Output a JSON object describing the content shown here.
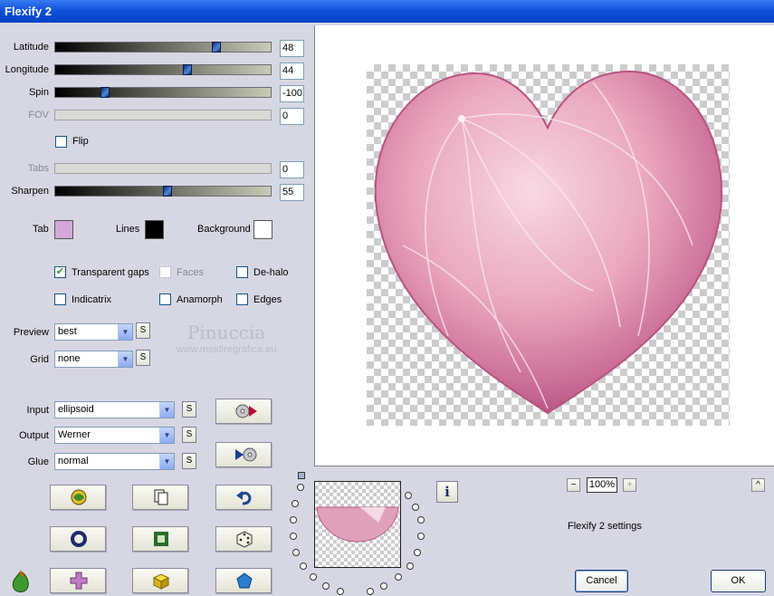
{
  "window": {
    "title": "Flexify 2"
  },
  "params": {
    "latitude": {
      "label": "Latitude",
      "value": "48",
      "fraction": 0.76
    },
    "longitude": {
      "label": "Longitude",
      "value": "44",
      "fraction": 0.62
    },
    "spin": {
      "label": "Spin",
      "value": "-100",
      "fraction": 0.22
    },
    "fov": {
      "label": "FOV",
      "value": "0"
    },
    "flip": {
      "label": "Flip",
      "checked": false
    },
    "tabs": {
      "label": "Tabs",
      "value": "0"
    },
    "sharpen": {
      "label": "Sharpen",
      "value": "55",
      "fraction": 0.52
    }
  },
  "colors": {
    "tab_label": "Tab",
    "tab_color": "#d4a8d8",
    "lines_label": "Lines",
    "lines_color": "#000000",
    "background_label": "Background",
    "background_color": "#ffffff"
  },
  "options": {
    "transparent_gaps": {
      "label": "Transparent gaps",
      "checked": true
    },
    "faces": {
      "label": "Faces",
      "checked": false
    },
    "de_halo": {
      "label": "De-halo",
      "checked": false
    },
    "indicatrix": {
      "label": "Indicatrix",
      "checked": false
    },
    "anamorph": {
      "label": "Anamorph",
      "checked": false
    },
    "edges": {
      "label": "Edges",
      "checked": false
    }
  },
  "dropdowns": {
    "preview": {
      "label": "Preview",
      "value": "best"
    },
    "grid": {
      "label": "Grid",
      "value": "none"
    },
    "input": {
      "label": "Input",
      "value": "ellipsoid"
    },
    "output": {
      "label": "Output",
      "value": "Werner"
    },
    "glue": {
      "label": "Glue",
      "value": "normal"
    }
  },
  "s_button_label": "S",
  "watermark": {
    "name": "Pinuccia",
    "url": "www.maidiregrafica.eu"
  },
  "zoom": {
    "minus": "−",
    "value": "100%",
    "plus": "+"
  },
  "settings_text": "Flexify 2 settings",
  "info_label": "i",
  "collapse_label": "^",
  "buttons": {
    "cancel": "Cancel",
    "ok": "OK"
  },
  "icons": {
    "input_to_output": "cd-to-play-icon",
    "output_to_input": "play-to-cd-icon",
    "randomize_colors": "palette-swirl-icon",
    "copy": "copy-pages-icon",
    "undo": "undo-arrow-icon",
    "circle": "ring-icon",
    "square": "square-frame-icon",
    "random": "dice-icon",
    "cross": "cross-shape-icon",
    "cube": "cube-icon",
    "polyhedron": "pentagon-icon",
    "logo": "flaming-pear-logo-icon"
  }
}
